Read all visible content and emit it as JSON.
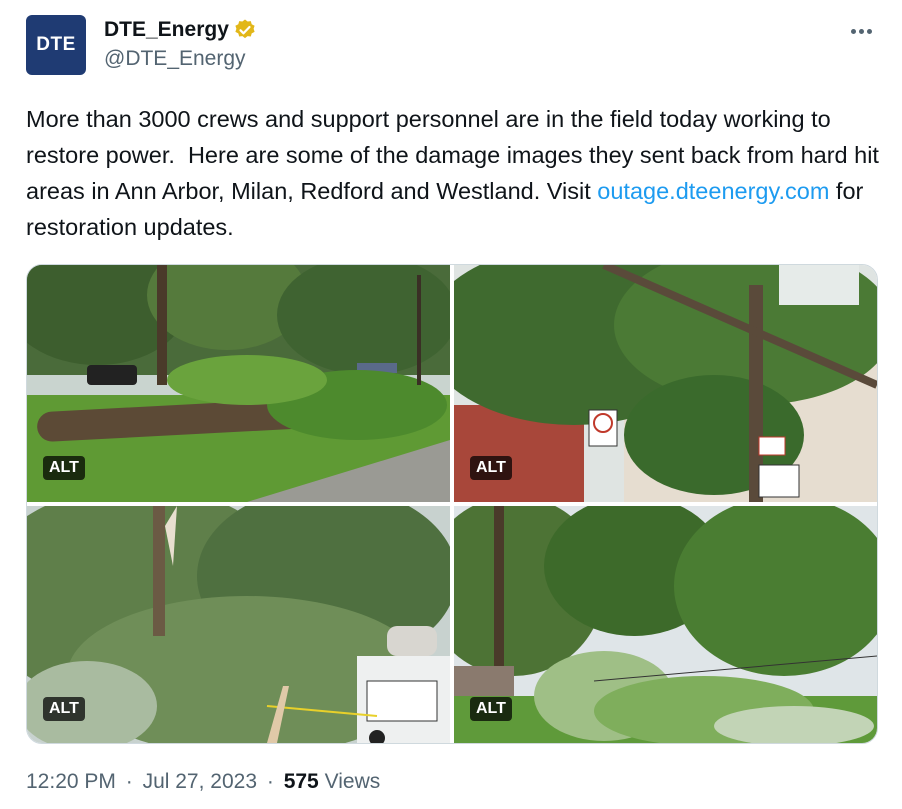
{
  "author": {
    "avatar_text": "DTE",
    "display_name": "DTE_Energy",
    "handle": "@DTE_Energy",
    "verified_color": "#e2b719"
  },
  "tweet": {
    "text_before_link": "More than 3000 crews and support personnel are in the field today working to restore power.  Here are some of the damage images they sent back from hard hit areas in Ann Arbor, Milan, Redford and Westland. Visit ",
    "link_text": "outage.dteenergy.com",
    "text_after_link": " for restoration updates."
  },
  "media": [
    {
      "alt_label": "ALT"
    },
    {
      "alt_label": "ALT"
    },
    {
      "alt_label": "ALT"
    },
    {
      "alt_label": "ALT"
    }
  ],
  "meta": {
    "time": "12:20 PM",
    "date": "Jul 27, 2023",
    "separator": "·",
    "views_count": "575",
    "views_label": "Views"
  },
  "colors": {
    "link": "#1d9bf0",
    "secondary_text": "#536471",
    "avatar_bg": "#1f3b73"
  }
}
